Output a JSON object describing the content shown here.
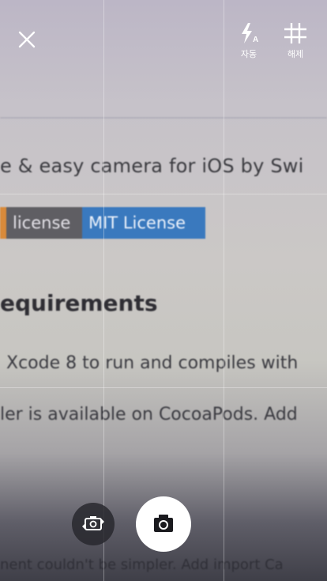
{
  "camera": {
    "flash_label": "자동",
    "grid_label": "해제"
  },
  "viewfinder": {
    "tagline": "e & easy camera for iOS by Swi",
    "badges": [
      {
        "label": "license",
        "color": "#5f5e63"
      },
      {
        "label": "MIT License",
        "color": "#3a79be"
      }
    ],
    "heading": "equirements",
    "line1": "Xcode 8 to run and compiles with",
    "line2": "ler is available on CocoaPods. Add",
    "line3": "nent couldn't be simpler. Add import Ca"
  },
  "icons": [
    "close-icon",
    "flash-auto-icon",
    "grid-icon",
    "switch-camera-icon",
    "camera-icon"
  ]
}
